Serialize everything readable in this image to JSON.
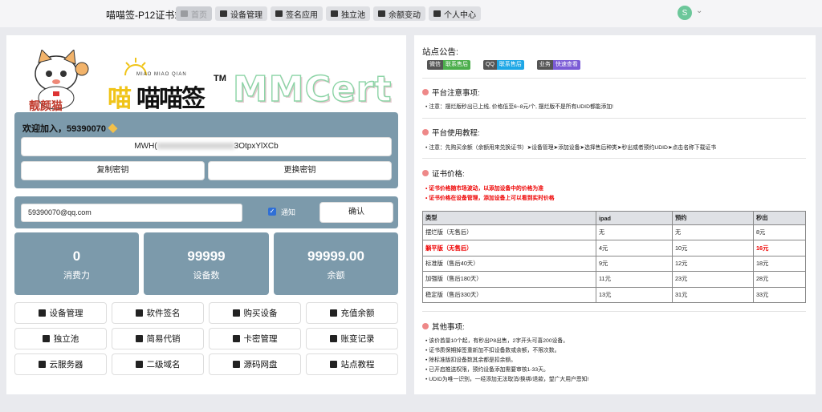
{
  "brand": "喵喵签-P12证书站",
  "nav": [
    {
      "label": "首页",
      "active": true
    },
    {
      "label": "设备管理"
    },
    {
      "label": "签名应用"
    },
    {
      "label": "独立池"
    },
    {
      "label": "余额变动"
    },
    {
      "label": "个人中心"
    }
  ],
  "user": {
    "avatar_letter": "S"
  },
  "logos": {
    "cat_text": "靓颜猫",
    "brand_cn": "喵喵签",
    "brand_pinyin": "MIAO MIAO QIAN",
    "tm": "TM",
    "mmcert": "MMCert"
  },
  "welcome": "欢迎加入，59390070",
  "key": {
    "prefix": "MWH(",
    "suffix": "3OtpxYlXCb"
  },
  "buttons": {
    "copy": "复制密钥",
    "change": "更换密钥",
    "confirm": "确认"
  },
  "email": "59390070@qq.com",
  "notify_label": "通知",
  "stats": [
    {
      "num": "0",
      "label": "消费力"
    },
    {
      "num": "99999",
      "label": "设备数"
    },
    {
      "num": "99999.00",
      "label": "余额"
    }
  ],
  "menu": [
    {
      "label": "设备管理",
      "icon": "laptop-icon"
    },
    {
      "label": "软件签名",
      "icon": "edit-icon"
    },
    {
      "label": "购买设备",
      "icon": "cart-icon"
    },
    {
      "label": "充值余额",
      "icon": "coins-icon"
    },
    {
      "label": "独立池",
      "icon": "cube-icon"
    },
    {
      "label": "简易代销",
      "icon": "user-icon"
    },
    {
      "label": "卡密管理",
      "icon": "key-icon"
    },
    {
      "label": "账变记录",
      "icon": "file-icon"
    },
    {
      "label": "云服务器",
      "icon": "book-icon"
    },
    {
      "label": "二级域名",
      "icon": "book-icon"
    },
    {
      "label": "源码网盘",
      "icon": "book-icon"
    },
    {
      "label": "站点教程",
      "icon": "book-icon"
    }
  ],
  "notice": {
    "title": "站点公告:",
    "badges": [
      {
        "a": "微信",
        "b": "联系售后",
        "color": "#4cae4c"
      },
      {
        "a": "QQ",
        "b": "联系售后",
        "color": "#1ea7e6"
      },
      {
        "a": "业务",
        "b": "快速查看",
        "color": "#7b5bd6"
      }
    ],
    "sections": [
      {
        "title": "平台注意事项:",
        "lines": [
          "• 注意：摆烂版秒出已上线, 价格低至6~8元/个, 摆烂版不是所有UDID都能添加!"
        ]
      },
      {
        "title": "平台使用教程:",
        "lines": [
          "• 注意：先购买余额（余额用来兑换证书）➤设备管理➤添加设备➤选择售后种类➤秒出或者预约UDID➤点击名称下载证书"
        ]
      },
      {
        "title": "证书价格:",
        "lines": [
          "• 证书价格随市场波动，以添加设备中的价格为准",
          "• 证书价格在设备管理，添加设备上可以看到实时价格"
        ]
      },
      {
        "title": "其他事项:",
        "lines": [
          "• 该价酋量10个起，有秒出P8出售，2字开头可喜200设备。",
          "• 证书质保期掉签重新加不扣设备数或余额，不限次数。",
          "• 除标准版扣设备数其余都是扣余额。",
          "• 已开启推送权限，预约设备添加需要审核1-33天。",
          "• UDID为唯一识别，一经添加无法取消/换绑/退款，望广大用户恩知!"
        ]
      }
    ],
    "table": {
      "headers": [
        "类型",
        "ipad",
        "预约",
        "秒出"
      ],
      "rows": [
        [
          "摆烂版（无售后）",
          "无",
          "无",
          "8元"
        ],
        [
          "躺平版（无售后）",
          "4元",
          "10元",
          "16元"
        ],
        [
          "标准版（售后40天）",
          "9元",
          "12元",
          "18元"
        ],
        [
          "加强版（售后180天）",
          "11元",
          "23元",
          "28元"
        ],
        [
          "稳定版（售后330天）",
          "13元",
          "31元",
          "33元"
        ]
      ]
    }
  }
}
